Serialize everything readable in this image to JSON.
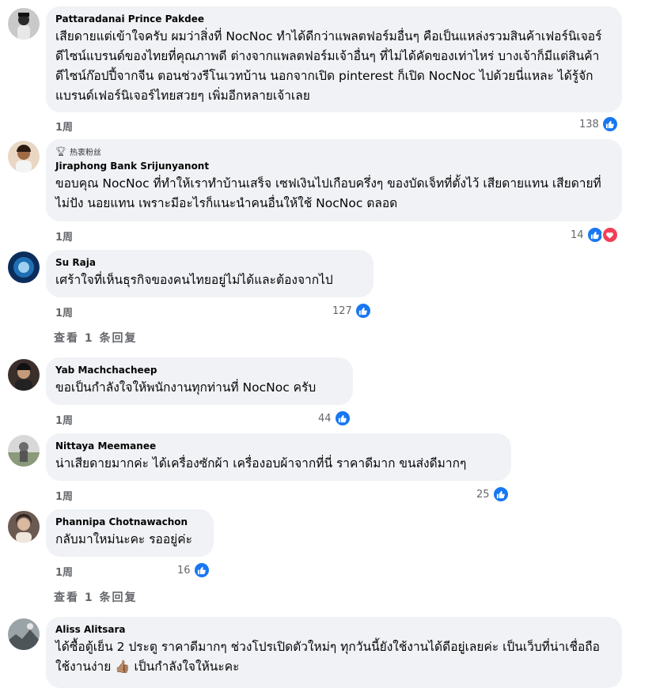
{
  "comments": [
    {
      "author": "Pattaradanai Prince Pakdee",
      "text": "เสียดายแต่เข้าใจครับ ผมว่าสิ่งที่ NocNoc ทำได้ดีกว่าแพลตฟอร์มอื่นๆ คือเป็นแหล่งรวมสินค้าเฟอร์นิเจอร์ ดีไซน์แบรนด์ของไทยที่คุณภาพดี ต่างจากแพลตฟอร์มเจ้าอื่นๆ ที่ไม่ได้คัดของเท่าไหร่ บางเจ้าก็มีแต่สินค้าดีไซน์ก๊อปปี้จากจีน ตอนช่วงรีโนเวทบ้าน นอกจากเปิด pinterest ก็เปิด NocNoc ไปด้วยนี่แหละ ได้รู้จักแบรนด์เฟอร์นิเจอร์ไทยสวยๆ เพิ่มอีกหลายเจ้าเลย",
      "time": "1周",
      "reactions": "138",
      "reaction_icons": [
        "like-icon"
      ]
    },
    {
      "badge": "热衷粉丝",
      "author": "Jiraphong Bank Srijunyanont",
      "text": "ขอบคุณ NocNoc ที่ทำให้เราทำบ้านเสร็จ เซฟเงินไปเกือบครึ่งๆ ของบัดเจ็ทที่ตั้งไว้ เสียดายแทน เสียดายที่ไม่ปัง นอยแทน เพราะมีอะไรก็แนะนำคนอื่นให้ใช้ NocNoc ตลอด",
      "time": "1周",
      "reactions": "14",
      "reaction_icons": [
        "like-icon",
        "heart-icon"
      ]
    },
    {
      "author": "Su Raja",
      "text": "เศร้าใจที่เห็นธุรกิจของคนไทยอยู่ไม่ได้และต้องจากไป",
      "time": "1周",
      "reactions": "127",
      "reaction_icons": [
        "like-icon"
      ],
      "replies_label": "查看 1 条回复"
    },
    {
      "author": "Yab Machchacheep",
      "text": "ขอเป็นกำลังใจให้พนักงานทุกท่านที่ NocNoc ครับ",
      "time": "1周",
      "reactions": "44",
      "reaction_icons": [
        "like-icon"
      ]
    },
    {
      "author": "Nittaya Meemanee",
      "text": "น่าเสียดายมากค่ะ ได้เครื่องซักผ้า เครื่องอบผ้าจากที่นี่ ราคาดีมาก ขนส่งดีมากๆ",
      "time": "1周",
      "reactions": "25",
      "reaction_icons": [
        "like-icon"
      ]
    },
    {
      "author": "Phannipa Chotnawachon",
      "text": "กลับมาใหม่นะคะ รออยู่ค่ะ",
      "time": "1周",
      "reactions": "16",
      "reaction_icons": [
        "like-icon"
      ],
      "replies_label": "查看 1 条回复"
    },
    {
      "author": "Aliss Alitsara",
      "text": "ได้ซื้อตู้เย็น 2 ประตู ราคาดีมากๆ ช่วงโปรเปิดตัวใหม่ๆ ทุกวันนี้ยังใช้งานได้ดีอยู่เลยค่ะ เป็นเว็บที่น่าเชื่อถือ ใช้งานง่าย 👍🏽 เป็นกำลังใจให้นะคะ"
    }
  ]
}
